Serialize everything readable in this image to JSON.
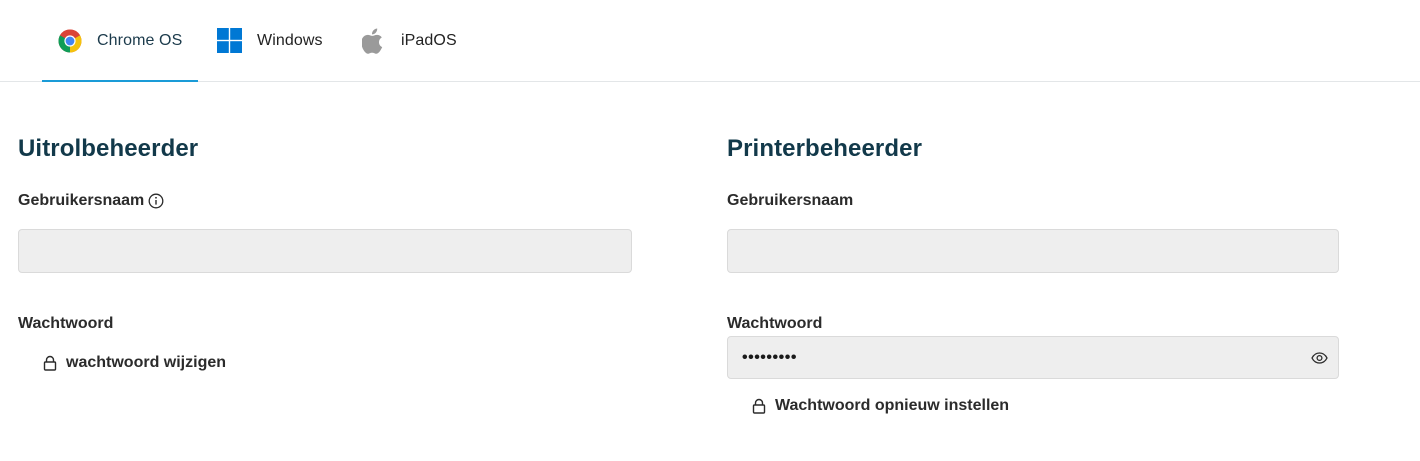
{
  "tabs": [
    {
      "label": "Chrome OS",
      "icon": "chrome-icon",
      "active": true
    },
    {
      "label": "Windows",
      "icon": "windows-icon",
      "active": false
    },
    {
      "label": "iPadOS",
      "icon": "apple-icon",
      "active": false
    }
  ],
  "colors": {
    "accent": "#1a9bd7",
    "heading": "#12394a",
    "input_bg": "#eeeeee"
  },
  "left_section": {
    "title": "Uitrolbeheerder",
    "username_label": "Gebruikersnaam",
    "username_value": "",
    "password_label": "Wachtwoord",
    "change_password_link": "wachtwoord wijzigen"
  },
  "right_section": {
    "title": "Printerbeheerder",
    "username_label": "Gebruikersnaam",
    "username_value": "",
    "password_label": "Wachtwoord",
    "password_masked": "•••••••••",
    "reset_password_link": "Wachtwoord opnieuw instellen"
  }
}
